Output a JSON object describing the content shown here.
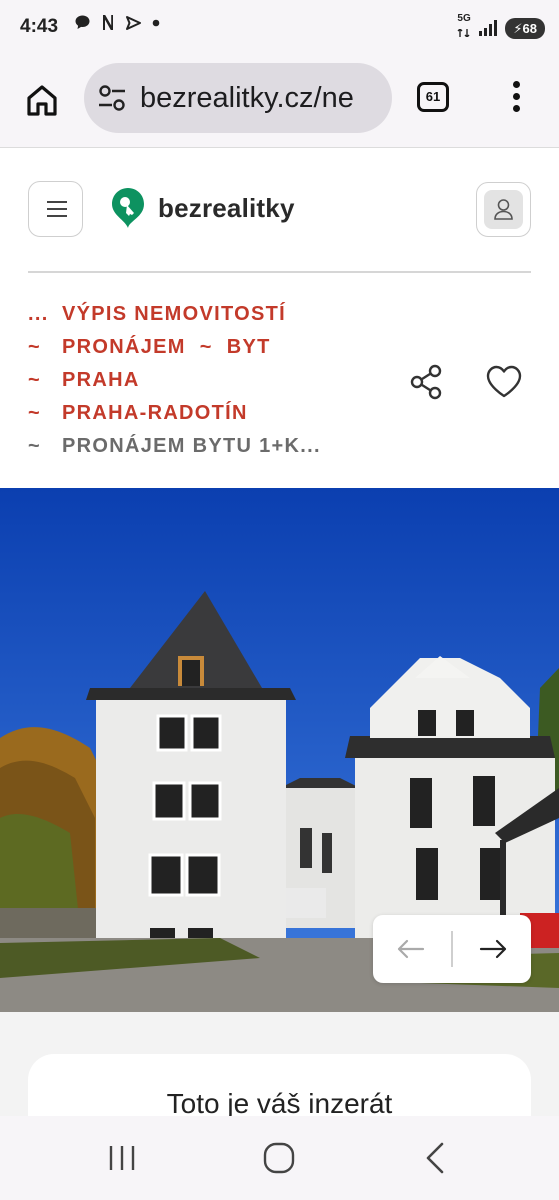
{
  "status_bar": {
    "time": "4:43",
    "notification_icons": [
      "chat-icon",
      "n-icon",
      "send-icon",
      "dot-icon"
    ],
    "network": "5G",
    "battery": "68"
  },
  "browser": {
    "url": "bezrealitky.cz/ne",
    "tab_count": "61"
  },
  "site": {
    "logo_text": "bezrealitky",
    "brand_color": "#0d9260",
    "accent_color": "#c33a2a"
  },
  "breadcrumbs": {
    "items": [
      {
        "sep": "...",
        "label": "VÝPIS NEMOVITOSTÍ"
      },
      {
        "sep": "~",
        "label": "PRONÁJEM",
        "sep2": "~",
        "label2": "BYT"
      },
      {
        "sep": "~",
        "label": "PRAHA"
      },
      {
        "sep": "~",
        "label": "PRAHA-RADOTÍN"
      },
      {
        "sep": "~",
        "label": "PRONÁJEM BYTU 1+K..."
      }
    ]
  },
  "gallery": {
    "prev_icon": "arrow-left-icon",
    "next_icon": "arrow-right-icon"
  },
  "owner_card": {
    "title": "Toto je váš inzerát"
  }
}
